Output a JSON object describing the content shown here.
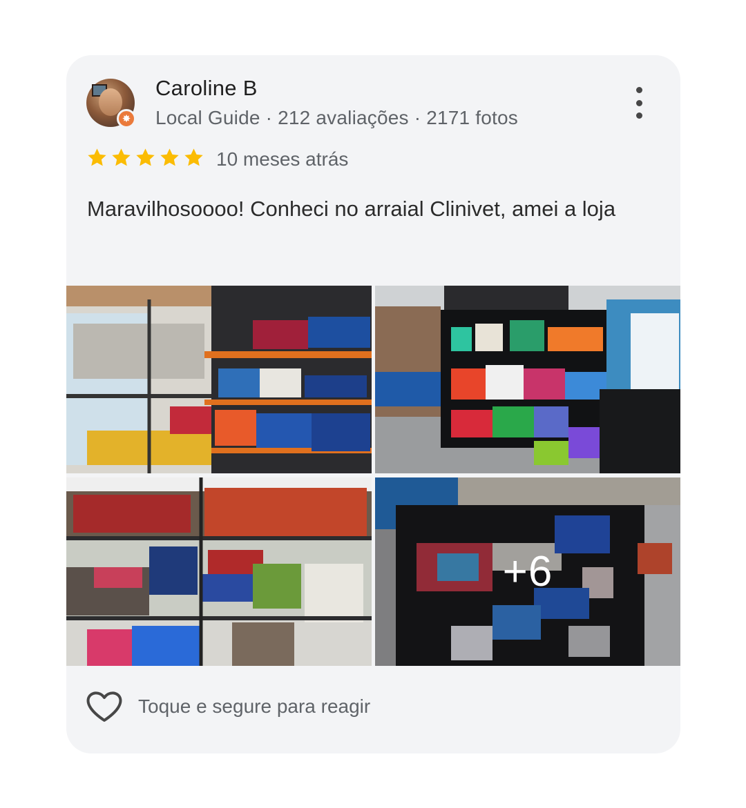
{
  "review": {
    "author": "Caroline B",
    "meta": "Local Guide · 212 avaliações · 2171 fotos",
    "rating": 5,
    "rating_max": 5,
    "time": "10 meses atrás",
    "text": "Maravilhosoooo! Conheci no arraial Clinivet, amei a loja",
    "photos": {
      "more_count_label": "+6"
    },
    "reaction": {
      "label": "Toque e segure para reagir",
      "icon": "heart-outline-icon"
    }
  },
  "colors": {
    "card_bg": "#f3f4f6",
    "star": "#fbbc04",
    "secondary_text": "#5f6368",
    "guide_badge": "#ea7a3b"
  }
}
